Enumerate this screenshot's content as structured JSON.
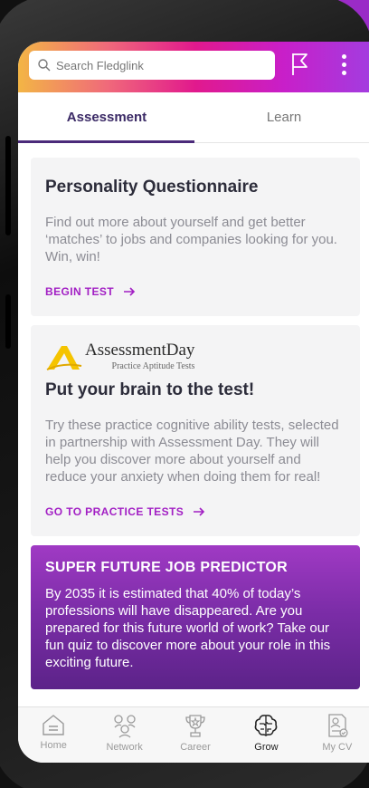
{
  "search": {
    "placeholder": "Search Fledglink"
  },
  "tabs": [
    {
      "label": "Assessment",
      "active": true
    },
    {
      "label": "Learn",
      "active": false
    }
  ],
  "cards": {
    "personality": {
      "title": "Personality Questionnaire",
      "body": "Find out more about yourself and get better ‘matches’ to jobs and companies looking for you. Win, win!",
      "cta": "BEGIN TEST"
    },
    "assessment_day": {
      "logo_title": "AssessmentDay",
      "logo_subtitle": "Practice Aptitude Tests",
      "title": "Put your brain to the test!",
      "body": "Try these practice cognitive ability tests, selected in partnership with Assessment Day. They will help you discover more about yourself and reduce your anxiety when doing them for real!",
      "cta": "GO TO PRACTICE TESTS"
    },
    "predictor": {
      "title": "SUPER FUTURE JOB PREDICTOR",
      "body": "By 2035 it is estimated that 40% of today’s professions will have disappeared. Are you prepared for this future world of work? Take our fun quiz to discover more about your role in this exciting future."
    }
  },
  "bottom_nav": [
    {
      "label": "Home",
      "icon": "home-icon",
      "active": false
    },
    {
      "label": "Network",
      "icon": "network-icon",
      "active": false
    },
    {
      "label": "Career",
      "icon": "trophy-icon",
      "active": false
    },
    {
      "label": "Grow",
      "icon": "brain-icon",
      "active": true
    },
    {
      "label": "My CV",
      "icon": "cv-icon",
      "active": false
    }
  ],
  "colors": {
    "accent": "#a21fc4",
    "tab_active": "#3b2a66",
    "header_gradient_start": "#f3b545",
    "header_gradient_end": "#a23de0"
  }
}
